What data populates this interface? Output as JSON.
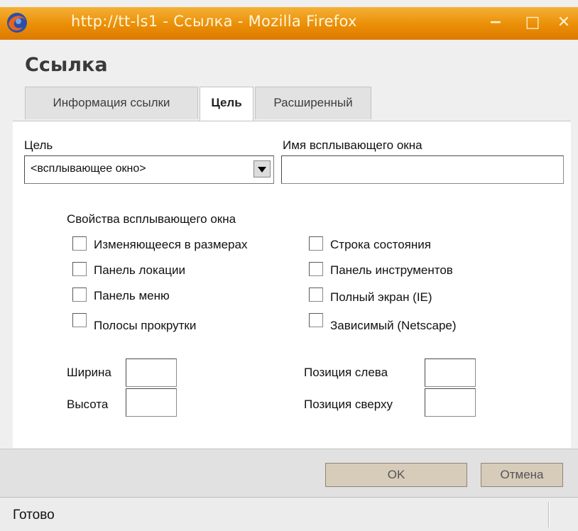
{
  "window": {
    "title": "http://tt-ls1 - Ссылка - Mozilla Firefox",
    "minimize": "−",
    "maximize": "□",
    "close": "✕"
  },
  "dialog": {
    "heading": "Ссылка",
    "tabs": [
      {
        "label": "Информация ссылки",
        "active": false
      },
      {
        "label": "Цель",
        "active": true
      },
      {
        "label": "Расширенный",
        "active": false
      }
    ]
  },
  "target": {
    "label": "Цель",
    "selected": "<всплывающее окно>",
    "popup_name_label": "Имя всплывающего окна",
    "popup_name_value": ""
  },
  "popup_props": {
    "heading": "Свойства всплывающего окна",
    "left": [
      {
        "label": "Изменяющееся в размерах",
        "checked": false
      },
      {
        "label": "Панель локации",
        "checked": false
      },
      {
        "label": "Панель меню",
        "checked": false
      },
      {
        "label": "Полосы прокрутки",
        "checked": false
      }
    ],
    "right": [
      {
        "label": "Строка состояния",
        "checked": false
      },
      {
        "label": "Панель инструментов",
        "checked": false
      },
      {
        "label": "Полный экран (IE)",
        "checked": false
      },
      {
        "label": "Зависимый (Netscape)",
        "checked": false
      }
    ]
  },
  "dimensions": {
    "width_label": "Ширина",
    "height_label": "Высота",
    "left_label": "Позиция слева",
    "top_label": "Позиция сверху"
  },
  "buttons": {
    "ok": "OK",
    "cancel": "Отмена"
  },
  "statusbar": {
    "text": "Готово"
  },
  "colors": {
    "titlebar": "#ea8e06",
    "button_bg": "#d7ccba"
  }
}
